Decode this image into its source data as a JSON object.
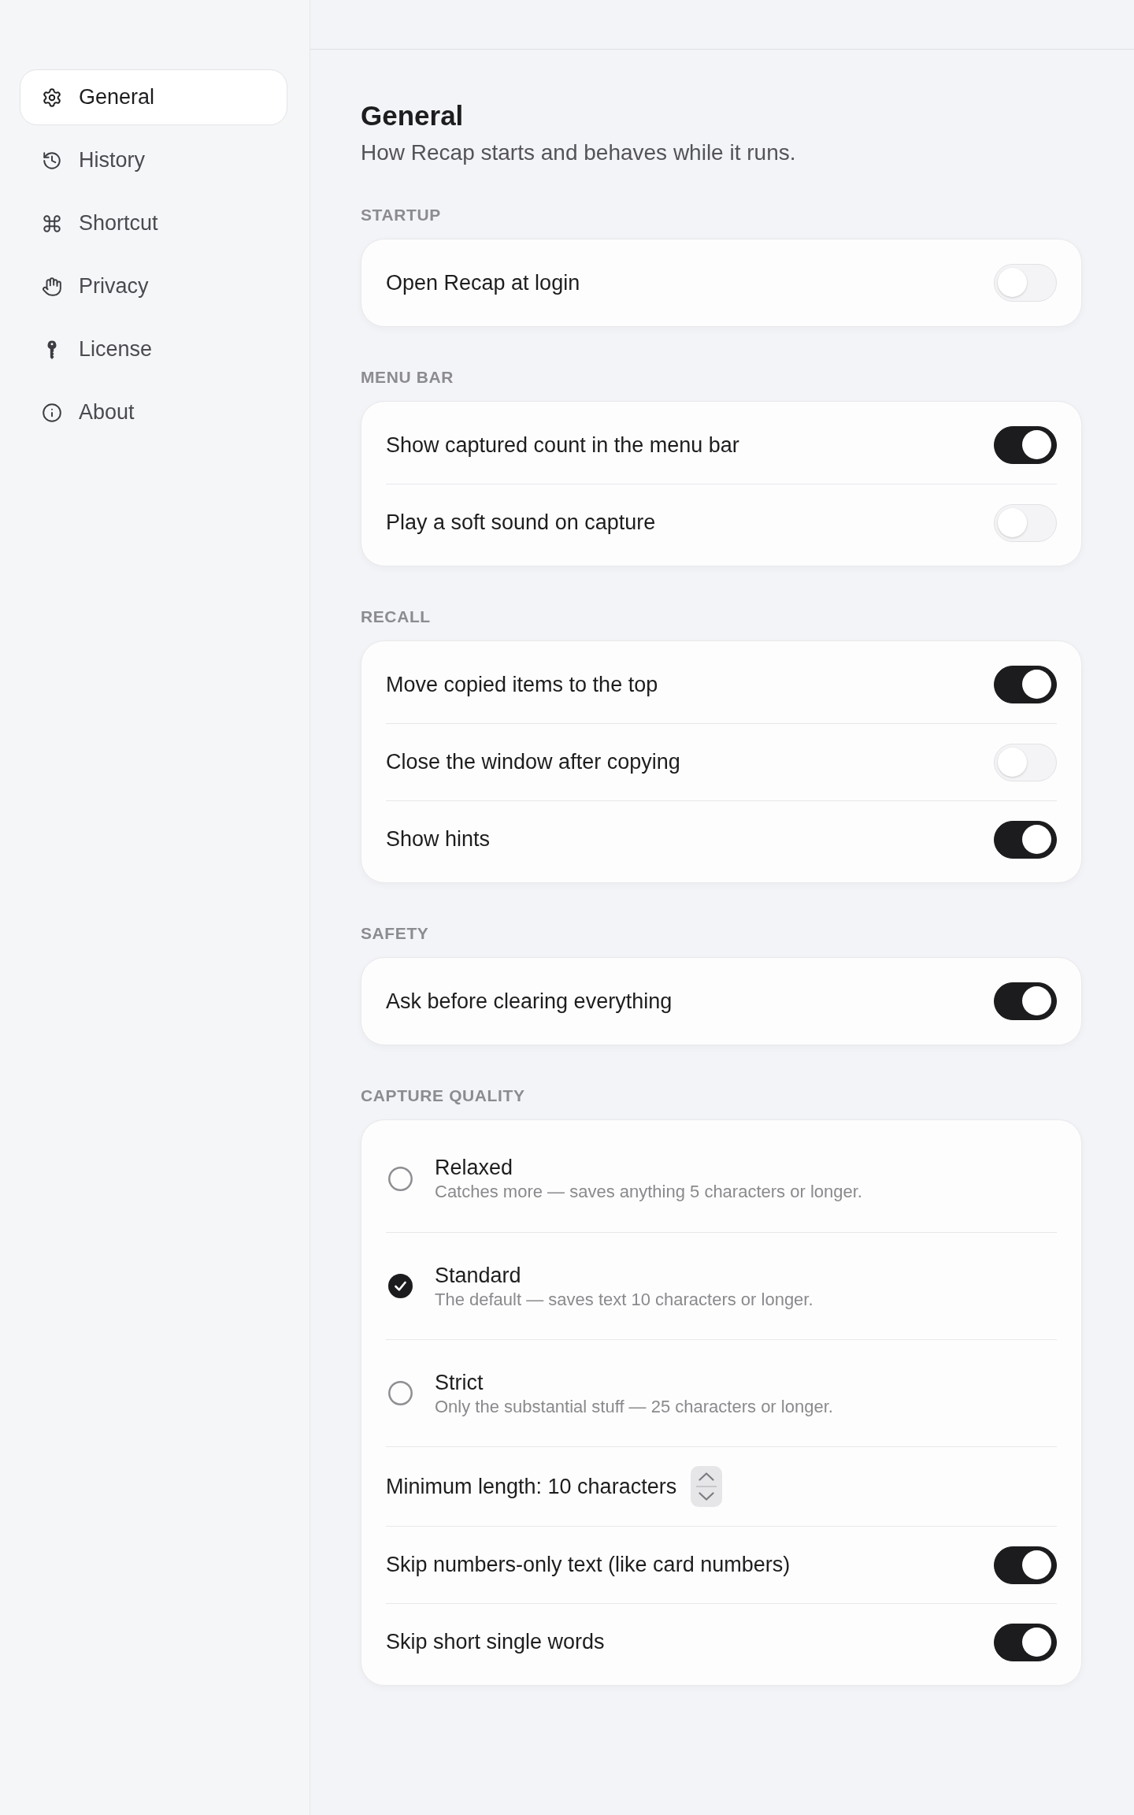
{
  "sidebar": {
    "items": [
      {
        "label": "General",
        "selected": true
      },
      {
        "label": "History",
        "selected": false
      },
      {
        "label": "Shortcut",
        "selected": false
      },
      {
        "label": "Privacy",
        "selected": false
      },
      {
        "label": "License",
        "selected": false
      },
      {
        "label": "About",
        "selected": false
      }
    ]
  },
  "header": {
    "title": "General",
    "subtitle": "How Recap starts and behaves while it runs."
  },
  "sections": [
    {
      "heading": "STARTUP",
      "rows": [
        {
          "kind": "toggle",
          "label": "Open Recap at login",
          "on": false
        }
      ]
    },
    {
      "heading": "MENU BAR",
      "rows": [
        {
          "kind": "toggle",
          "label": "Show captured count in the menu bar",
          "on": true
        },
        {
          "kind": "toggle",
          "label": "Play a soft sound on capture",
          "on": false
        }
      ]
    },
    {
      "heading": "RECALL",
      "rows": [
        {
          "kind": "toggle",
          "label": "Move copied items to the top",
          "on": true
        },
        {
          "kind": "toggle",
          "label": "Close the window after copying",
          "on": false
        },
        {
          "kind": "toggle",
          "label": "Show hints",
          "on": true
        }
      ]
    },
    {
      "heading": "SAFETY",
      "rows": [
        {
          "kind": "toggle",
          "label": "Ask before clearing everything",
          "on": true
        }
      ]
    },
    {
      "heading": "CAPTURE QUALITY",
      "rows": [
        {
          "kind": "radio",
          "label": "Relaxed",
          "description": "Catches more — saves anything 5 characters or longer.",
          "selected": false
        },
        {
          "kind": "radio",
          "label": "Standard",
          "description": "The default — saves text 10 characters or longer.",
          "selected": true
        },
        {
          "kind": "radio",
          "label": "Strict",
          "description": "Only the substantial stuff — 25 characters or longer.",
          "selected": false
        },
        {
          "kind": "stepper",
          "label": "Minimum length: 10 characters"
        },
        {
          "kind": "toggle",
          "label": "Skip numbers-only text (like card numbers)",
          "on": true
        },
        {
          "kind": "toggle",
          "label": "Skip short single words",
          "on": true
        }
      ]
    }
  ]
}
